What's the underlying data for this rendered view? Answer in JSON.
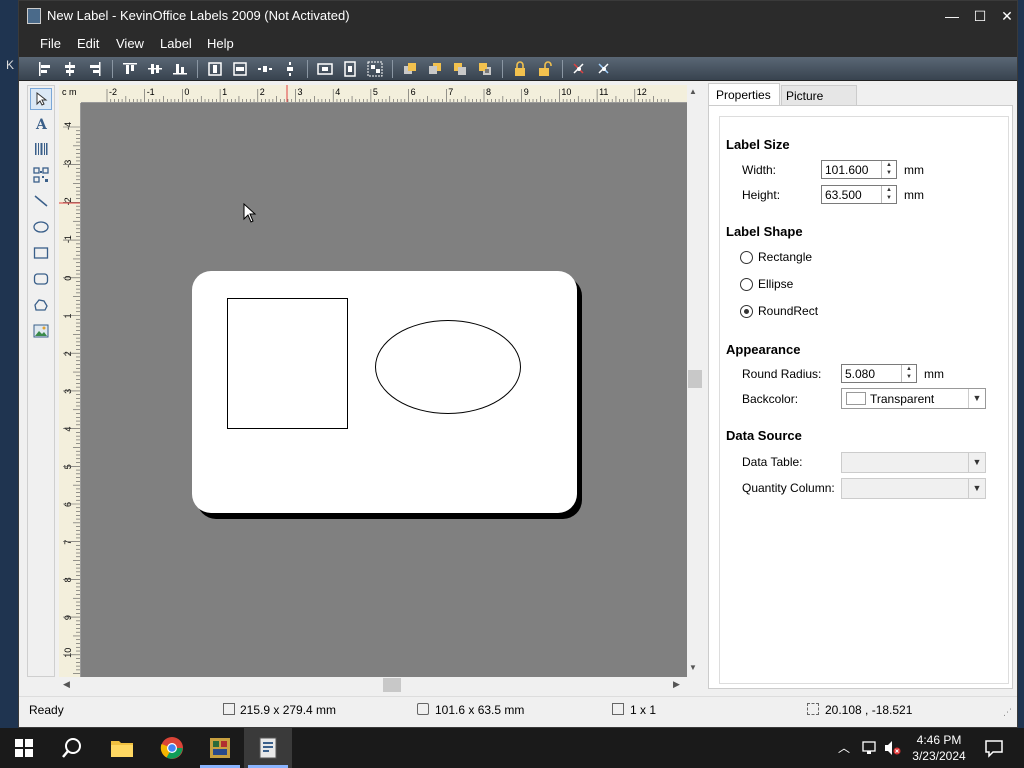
{
  "window": {
    "title": "New Label - KevinOffice Labels 2009 (Not Activated)",
    "controls": {
      "minimize": "—",
      "maximize": "☐",
      "close": "✕"
    }
  },
  "desktop": {
    "edge_letter": "K"
  },
  "menu": [
    "File",
    "Edit",
    "View",
    "Label",
    "Help"
  ],
  "toolbar_icons": [
    "align-left-icon",
    "align-center-icon",
    "align-right-icon",
    "align-top-icon",
    "align-middle-icon",
    "align-bottom-icon",
    "same-width-icon",
    "same-height-icon",
    "space-horizontal-icon",
    "space-vertical-icon",
    "center-horizontal-icon",
    "center-vertical-icon",
    "group-icon",
    "bring-front-icon",
    "send-back-icon",
    "bring-forward-icon",
    "send-backward-icon",
    "lock-icon",
    "unlock-icon",
    "rotate-left-icon",
    "rotate-right-icon"
  ],
  "tools": [
    "pointer-tool",
    "text-tool",
    "barcode-tool",
    "qrcode-tool",
    "line-tool",
    "ellipse-tool",
    "rectangle-tool",
    "roundrect-tool",
    "polygon-tool",
    "picture-tool"
  ],
  "ruler": {
    "unit": "c m",
    "top_ticks": [
      "-2",
      "-1",
      "0",
      "1",
      "2",
      "3",
      "4",
      "5",
      "6",
      "7",
      "8",
      "9",
      "10",
      "11",
      "12"
    ],
    "left_ticks": [
      "-4",
      "-3",
      "-2",
      "-1",
      "0",
      "1",
      "2",
      "3",
      "4",
      "5",
      "6",
      "7",
      "8",
      "9",
      "10"
    ]
  },
  "tabs": {
    "properties": "Properties",
    "picture_library": "Picture Library"
  },
  "label_size": {
    "heading": "Label Size",
    "width_label": "Width:",
    "width_value": "101.600",
    "width_unit": "mm",
    "height_label": "Height:",
    "height_value": "63.500",
    "height_unit": "mm"
  },
  "label_shape": {
    "heading": "Label Shape",
    "options": [
      "Rectangle",
      "Ellipse",
      "RoundRect"
    ],
    "selected": "RoundRect"
  },
  "appearance": {
    "heading": "Appearance",
    "radius_label": "Round Radius:",
    "radius_value": "5.080",
    "radius_unit": "mm",
    "backcolor_label": "Backcolor:",
    "backcolor_value": "Transparent"
  },
  "data_source": {
    "heading": "Data Source",
    "table_label": "Data Table:",
    "table_value": "",
    "qty_label": "Quantity Column:",
    "qty_value": ""
  },
  "status": {
    "state": "Ready",
    "page_size": "215.9 x 279.4 mm",
    "label_size": "101.6 x 63.5 mm",
    "grid": "1 x 1",
    "position": "20.108 , -18.521"
  },
  "taskbar": {
    "time": "4:46 PM",
    "date": "3/23/2024"
  },
  "colors": {
    "canvas": "#808080",
    "titlebar": "#2b2b2b",
    "accent": "#8ab4ff"
  }
}
